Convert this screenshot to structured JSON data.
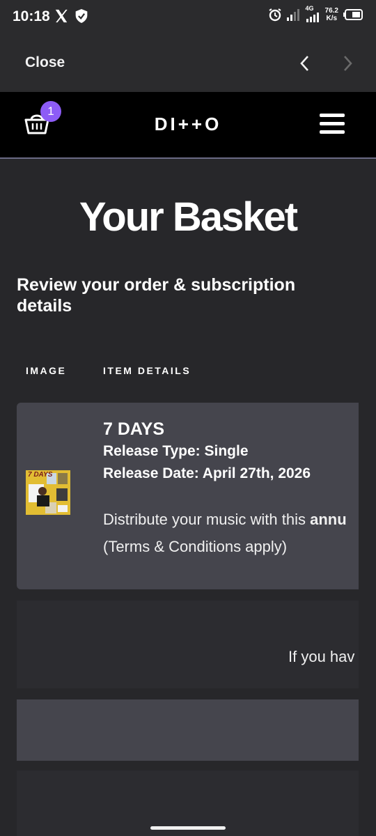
{
  "status_bar": {
    "time": "10:18",
    "net_speed_value": "76.2",
    "net_speed_unit": "K/s",
    "network_type": "4G",
    "icons": [
      "x-icon",
      "shield-icon",
      "alarm-icon",
      "signal-icon",
      "signal-icon",
      "battery-icon"
    ]
  },
  "browser_bar": {
    "close_label": "Close",
    "back_icon": "chevron-left-icon",
    "forward_icon": "chevron-right-icon"
  },
  "header": {
    "logo": "DI++O",
    "cart_count": "1",
    "basket_icon": "basket-icon",
    "menu_icon": "hamburger-menu-icon",
    "accent_color": "#8d5cf6"
  },
  "page": {
    "title": "Your Basket",
    "subtitle": "Review your order & subscription details",
    "columns": [
      "IMAGE",
      "ITEM DETAILS"
    ]
  },
  "item": {
    "name": "7 DAYS",
    "release_type": "Release Type: Single",
    "release_date": "Release Date: April 27th, 2026",
    "description_prefix": "Distribute your music with this ",
    "description_bold": "annu",
    "terms": "(Terms & Conditions apply)",
    "cover_text": "7 DAYS"
  },
  "info_row": {
    "text": "If you hav"
  }
}
